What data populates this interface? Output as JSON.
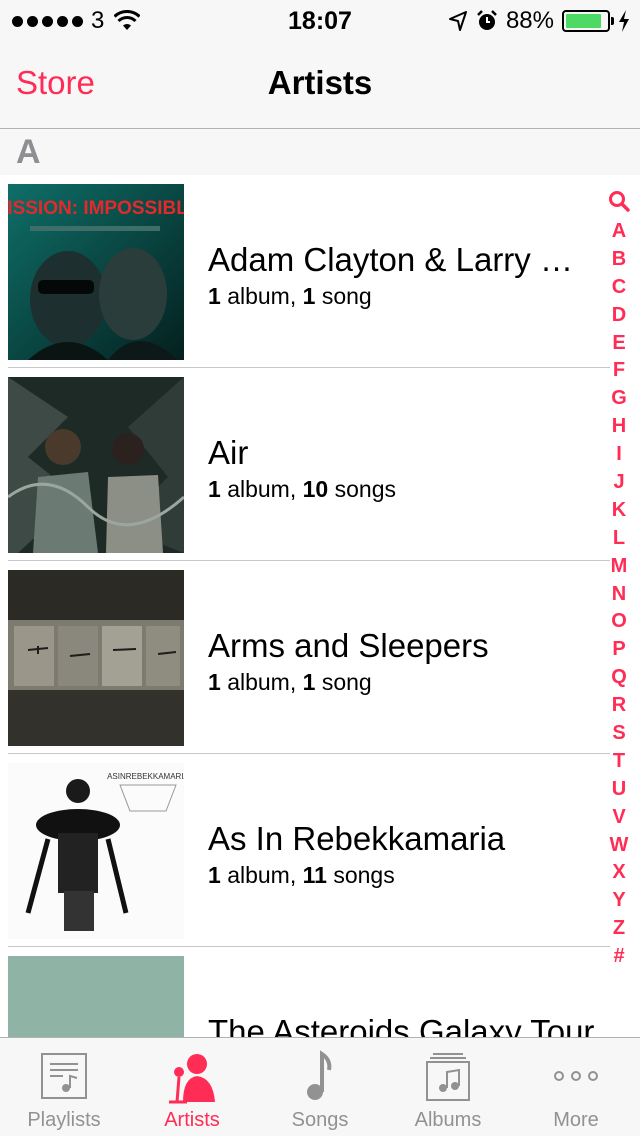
{
  "status_bar": {
    "carrier": "3",
    "time": "18:07",
    "battery": "88%",
    "battery_level": 0.88,
    "icons": [
      "signal-dots-icon",
      "wifi-icon",
      "location-arrow-icon",
      "alarm-clock-icon",
      "battery-icon",
      "charging-bolt-icon"
    ]
  },
  "nav": {
    "back_label": "Store",
    "title": "Artists"
  },
  "section": {
    "letter": "A"
  },
  "artists": [
    {
      "name": "Adam Clayton & Larry Mullen",
      "albums": "1",
      "album_word": "album",
      "songs": "1",
      "song_word": "song"
    },
    {
      "name": "Air",
      "albums": "1",
      "album_word": "album",
      "songs": "10",
      "song_word": "songs"
    },
    {
      "name": "Arms and Sleepers",
      "albums": "1",
      "album_word": "album",
      "songs": "1",
      "song_word": "song"
    },
    {
      "name": "As In Rebekkamaria",
      "albums": "1",
      "album_word": "album",
      "songs": "11",
      "song_word": "songs"
    },
    {
      "name": "The Asteroids Galaxy Tour",
      "albums": "",
      "album_word": "",
      "songs": "",
      "song_word": ""
    }
  ],
  "artwork_text": {
    "mission_title": "MISSION: IMPOSSIBLE",
    "rebekka_title": "ASINREBEKKAMARIA"
  },
  "index": [
    "A",
    "B",
    "C",
    "D",
    "E",
    "F",
    "G",
    "H",
    "I",
    "J",
    "K",
    "L",
    "M",
    "N",
    "O",
    "P",
    "Q",
    "R",
    "S",
    "T",
    "U",
    "V",
    "W",
    "X",
    "Y",
    "Z",
    "#"
  ],
  "tabs": [
    {
      "label": "Playlists",
      "icon": "playlists-icon",
      "active": false
    },
    {
      "label": "Artists",
      "icon": "artists-icon",
      "active": true
    },
    {
      "label": "Songs",
      "icon": "songs-icon",
      "active": false
    },
    {
      "label": "Albums",
      "icon": "albums-icon",
      "active": false
    },
    {
      "label": "More",
      "icon": "more-icon",
      "active": false
    }
  ],
  "colors": {
    "accent": "#ff2d55",
    "battery": "#4cd964",
    "inactive_tab": "#929292"
  }
}
